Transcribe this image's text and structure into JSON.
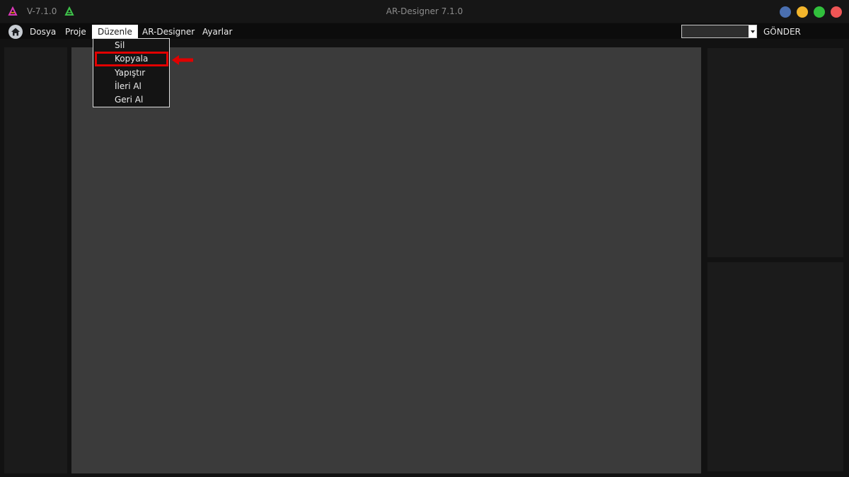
{
  "titlebar": {
    "version": "V-7.1.0",
    "title": "AR-Designer 7.1.0",
    "logo_left_icon": "triangle-a-logo-icon",
    "logo_right_icon": "triangle-a-logo-icon",
    "window_buttons": [
      {
        "name": "window-button-blue",
        "color": "#4a6fb0"
      },
      {
        "name": "window-button-yellow",
        "color": "#f2b52c"
      },
      {
        "name": "window-button-green",
        "color": "#31c03c"
      },
      {
        "name": "window-button-red",
        "color": "#ef5656"
      }
    ]
  },
  "menubar": {
    "home_icon": "home-icon",
    "items": [
      {
        "label": "Dosya"
      },
      {
        "label": "Proje"
      },
      {
        "label": "Düzenle"
      },
      {
        "label": "AR-Designer"
      },
      {
        "label": "Ayarlar"
      }
    ],
    "active_index": 2
  },
  "toolbar_right": {
    "combo_value": "",
    "send_label": "GÖNDER"
  },
  "dropdown": {
    "items": [
      {
        "label": "Sil"
      },
      {
        "label": "Kopyala"
      },
      {
        "label": "Yapıştır"
      },
      {
        "label": "İleri Al"
      },
      {
        "label": "Geri Al"
      }
    ],
    "highlighted_index": 1,
    "highlight_color": "#e10000"
  },
  "colors": {
    "accent_red": "#e10000",
    "canvas": "#3b3b3b",
    "panel": "#1b1b1b"
  }
}
